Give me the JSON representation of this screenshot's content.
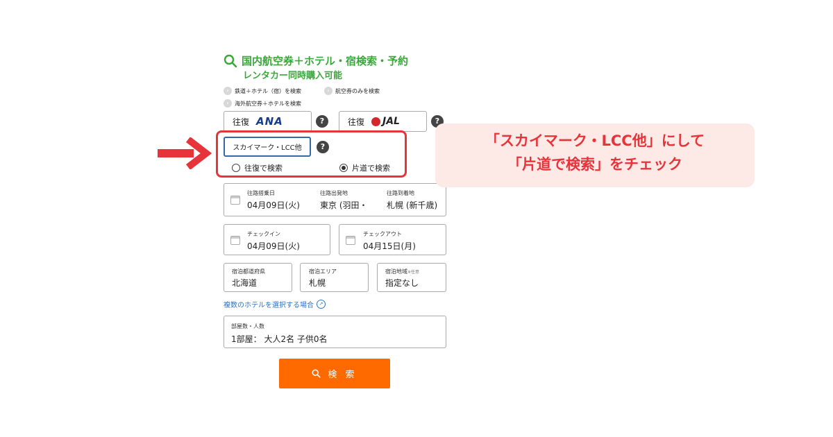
{
  "header": {
    "title_line1": "国内航空券＋ホテル・宿検索・予約",
    "title_line2": "レンタカー同時購入可能",
    "links": {
      "rail_hotel": "鉄道＋ホテル（宿）を検索",
      "air_only": "航空券のみを検索",
      "overseas": "海外航空券＋ホテルを検索"
    }
  },
  "airlines": {
    "ana_prefix": "往復",
    "ana_logo": "ANA",
    "jal_prefix": "往復",
    "jal_logo": "JAL",
    "lcc_label": "スカイマーク・LCC他",
    "help": "?"
  },
  "trip_type": {
    "round_trip": "往復で検索",
    "one_way": "片道で検索",
    "selected": "one_way"
  },
  "flight": {
    "date_label": "往路搭乗日",
    "date_value": "04月09日(火)",
    "from_label": "往路出発地",
    "from_value": "東京 (羽田・",
    "to_label": "往路到着地",
    "to_value": "札幌 (新千歳)"
  },
  "stay": {
    "checkin_label": "チェックイン",
    "checkin_value": "04月09日(火)",
    "checkout_label": "チェックアウト",
    "checkout_value": "04月15日(月)"
  },
  "area": {
    "pref_label": "宿泊都道府県",
    "pref_value": "北海道",
    "area_label": "宿泊エリア",
    "area_value": "札幌",
    "region_label": "宿泊地域",
    "region_optional": "※任意",
    "region_value": "指定なし"
  },
  "multi_hotel_link": "複数のホテルを選択する場合",
  "rooms": {
    "label": "部屋数・人数",
    "value": "1部屋： 大人2名 子供0名"
  },
  "search_button": "検 索",
  "annotation": {
    "line1": "「スカイマーク・LCC他」にして",
    "line2": "「片道で検索」をチェック"
  },
  "colors": {
    "brand_green": "#3aa73a",
    "accent_red": "#e7343a",
    "search_orange": "#ff6a00",
    "link_blue": "#2b73c2"
  }
}
